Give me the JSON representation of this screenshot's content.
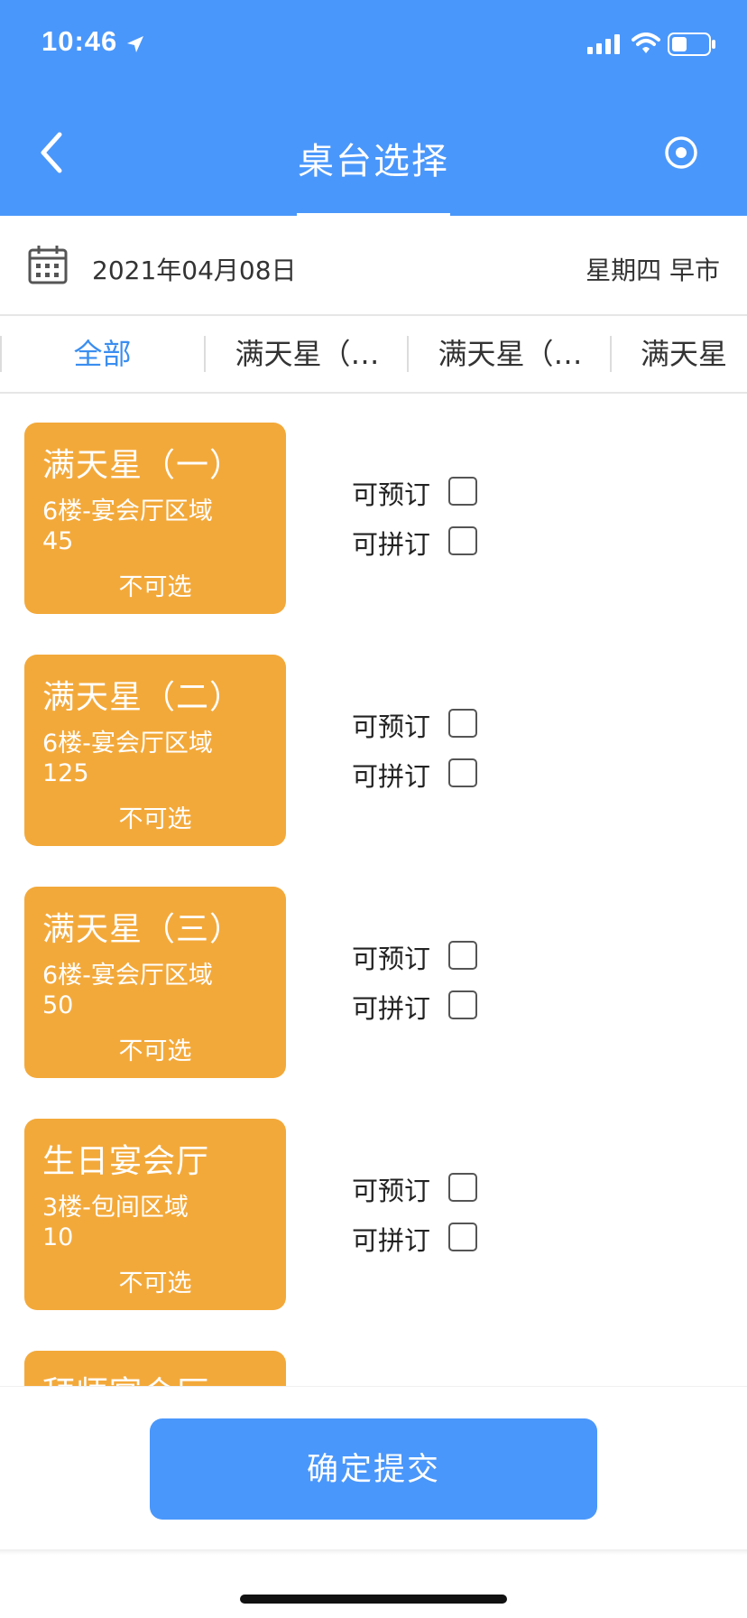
{
  "status": {
    "time": "10:46"
  },
  "nav": {
    "title": "桌台选择"
  },
  "date_row": {
    "date": "2021年04月08日",
    "day": "星期四 早市"
  },
  "tabs": [
    {
      "label": "全部",
      "active": true
    },
    {
      "label": "满天星（…",
      "active": false
    },
    {
      "label": "满天星（…",
      "active": false
    },
    {
      "label": "满天星",
      "active": false
    }
  ],
  "tables": [
    {
      "name": "满天星（一）",
      "area": "6楼-宴会厅区域",
      "capacity": "45",
      "status": "不可选",
      "opt1": "可预订",
      "opt2": "可拼订"
    },
    {
      "name": "满天星（二）",
      "area": "6楼-宴会厅区域",
      "capacity": "125",
      "status": "不可选",
      "opt1": "可预订",
      "opt2": "可拼订"
    },
    {
      "name": "满天星（三）",
      "area": "6楼-宴会厅区域",
      "capacity": "50",
      "status": "不可选",
      "opt1": "可预订",
      "opt2": "可拼订"
    },
    {
      "name": "生日宴会厅",
      "area": "3楼-包间区域",
      "capacity": "10",
      "status": "不可选",
      "opt1": "可预订",
      "opt2": "可拼订"
    },
    {
      "name": "拜师宴会厅"
    }
  ],
  "footer": {
    "submit_label": "确定提交"
  },
  "colors": {
    "primary": "#4a97fb",
    "card": "#f3a93a",
    "tab_active": "#3a8ef0"
  }
}
